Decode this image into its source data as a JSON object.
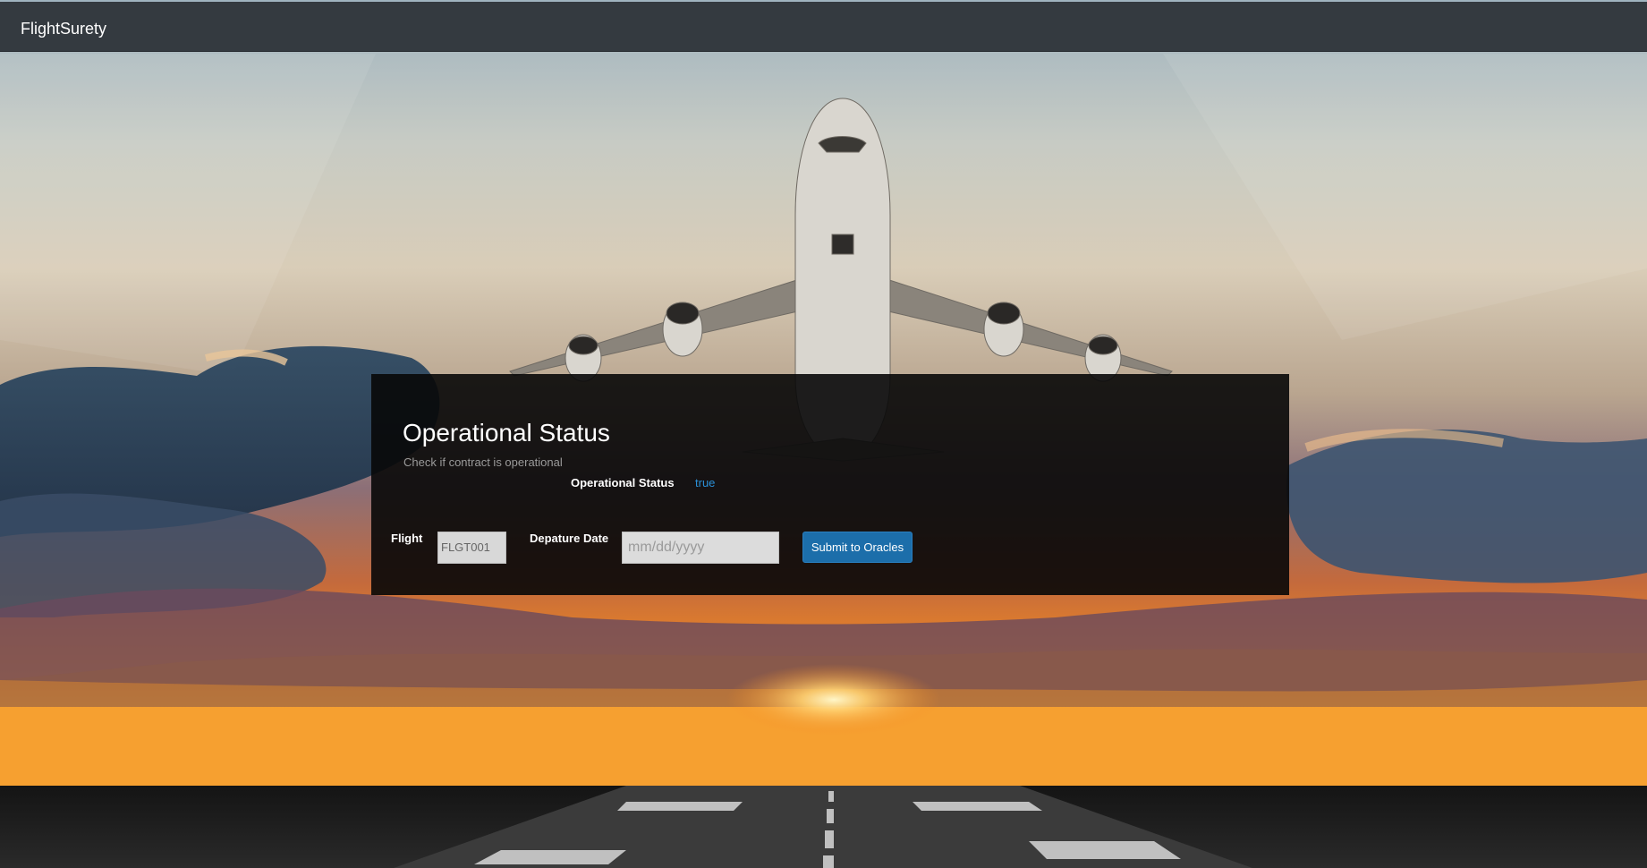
{
  "navbar": {
    "brand": "FlightSurety"
  },
  "status_panel": {
    "title": "Operational Status",
    "subtitle": "Check if contract is operational",
    "status_label": "Operational Status",
    "status_value": "true"
  },
  "oracle_form": {
    "flight_label": "Flight",
    "flight_selected": "FLGT001",
    "date_label": "Depature Date",
    "date_placeholder": "mm/dd/yyyy",
    "submit_label": "Submit to Oracles"
  },
  "colors": {
    "navbar_bg": "#343a40",
    "status_value": "#2a8fd6",
    "button_bg": "#1c6eaa"
  },
  "background": {
    "description_icon": "airplane-takeoff-sunset-image"
  }
}
